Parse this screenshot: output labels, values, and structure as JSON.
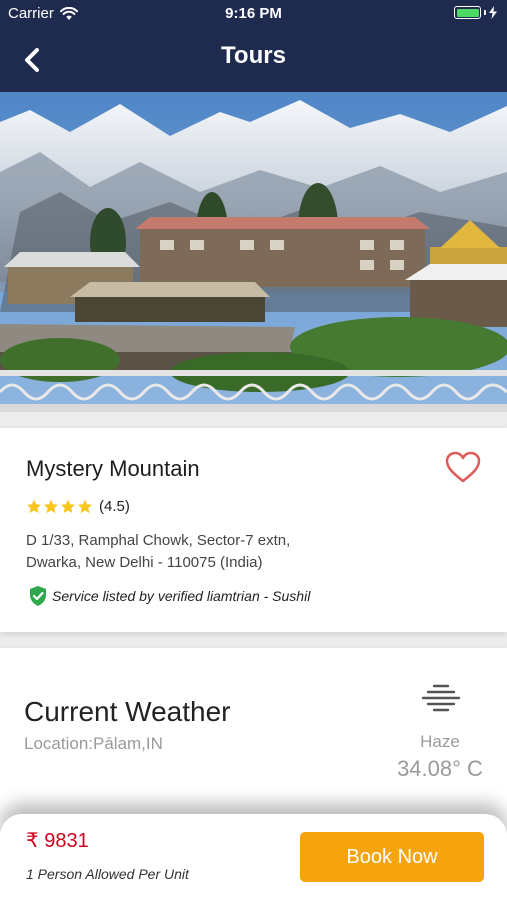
{
  "statusbar": {
    "carrier": "Carrier",
    "time": "9:16 PM",
    "battery_level": 1.0
  },
  "navbar": {
    "title": "Tours",
    "back_icon": "chevron-left-icon"
  },
  "tour": {
    "name": "Mystery Mountain",
    "rating": 4.5,
    "rating_text": "(4.5)",
    "address": "D 1/33, Ramphal Chowk, Sector-7 extn, Dwarka, New Delhi - 110075 (India)",
    "verified_text": "Service listed by verified liamtrian - Sushil",
    "favorite_icon": "heart-outline-icon"
  },
  "weather": {
    "title": "Current Weather",
    "location": "Location:Pālam,IN",
    "condition": "Haze",
    "temperature": "34.08° C",
    "icon": "haze-icon"
  },
  "booking": {
    "price": "₹ 9831",
    "allowed": "1 Person Allowed Per Unit",
    "button_label": "Book Now"
  },
  "colors": {
    "navbar": "#1f2a4f",
    "price": "#d0021b",
    "book_button": "#f5a40e",
    "star": "#f7c51b",
    "verified_badge": "#2ea84a",
    "heart": "#e05a5a"
  }
}
